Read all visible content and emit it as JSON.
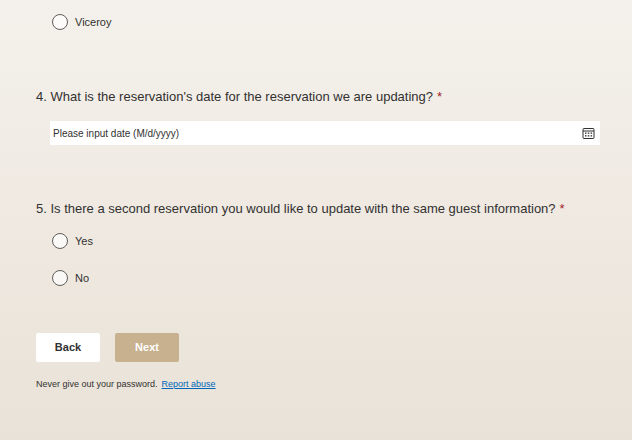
{
  "previous_question": {
    "options": [
      {
        "label": "Viceroy",
        "selected": false
      }
    ]
  },
  "questions": [
    {
      "title": "4. What is the reservation's date for the reservation we are updating?",
      "required_mark": "*",
      "kind": "date",
      "placeholder": "Please input date (M/d/yyyy)"
    },
    {
      "title": "5. Is there a second reservation you would like to update with the same guest information?",
      "required_mark": "*",
      "kind": "choice",
      "options": [
        {
          "label": "Yes",
          "selected": false
        },
        {
          "label": "No",
          "selected": false
        }
      ]
    }
  ],
  "buttons": [
    {
      "label": "Back",
      "kind": "secondary"
    },
    {
      "label": "Next",
      "kind": "primary"
    }
  ],
  "footer": {
    "notice": "Never give out your password.",
    "link": "Report abuse"
  }
}
